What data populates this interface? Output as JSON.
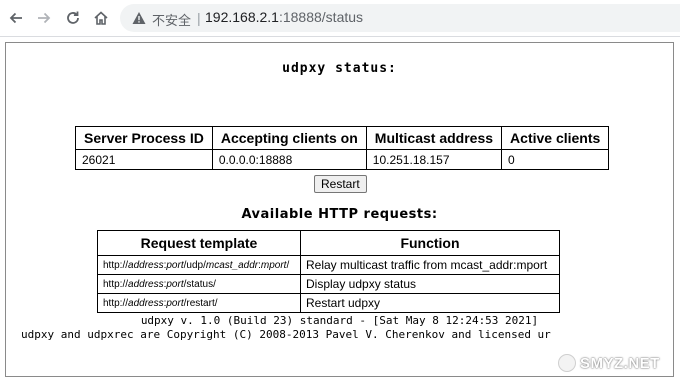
{
  "browser": {
    "security_label": "不安全",
    "url_host": "192.168.2.1",
    "url_rest": ":18888/status",
    "icons": [
      "back-arrow-icon",
      "forward-arrow-icon",
      "reload-icon",
      "home-icon",
      "warning-icon"
    ]
  },
  "page": {
    "title": "udpxy status:",
    "status_table": {
      "headers": [
        "Server Process ID",
        "Accepting clients on",
        "Multicast address",
        "Active clients"
      ],
      "row": [
        "26021",
        "0.0.0.0:18888",
        "10.251.18.157",
        "0"
      ]
    },
    "restart_label": "Restart",
    "requests_title": "Available HTTP requests:",
    "requests_table": {
      "headers": [
        "Request template",
        "Function"
      ],
      "rows": [
        {
          "tpl_prefix": "http://",
          "tpl_a": "address",
          "tpl_c1": ":",
          "tpl_b": "port",
          "tpl_mid": "/udp/",
          "tpl_c": "mcast_addr",
          "tpl_c2": ":",
          "tpl_d": "mport",
          "tpl_end": "/",
          "function": "Relay multicast traffic from mcast_addr:mport"
        },
        {
          "tpl_prefix": "http://",
          "tpl_a": "address",
          "tpl_c1": ":",
          "tpl_b": "port",
          "tpl_mid": "/status/",
          "function": "Display udpxy status"
        },
        {
          "tpl_prefix": "http://",
          "tpl_a": "address",
          "tpl_c1": ":",
          "tpl_b": "port",
          "tpl_mid": "/restart/",
          "function": "Restart udpxy"
        }
      ]
    },
    "footer_version": "udpxy v. 1.0 (Build 23) standard - [Sat May 8 12:24:53 2021]",
    "footer_copyright": "udpxy and udpxrec are Copyright (C) 2008-2013 Pavel V. Cherenkov and licensed ur"
  },
  "watermark": {
    "text": "SMYZ.NET"
  }
}
